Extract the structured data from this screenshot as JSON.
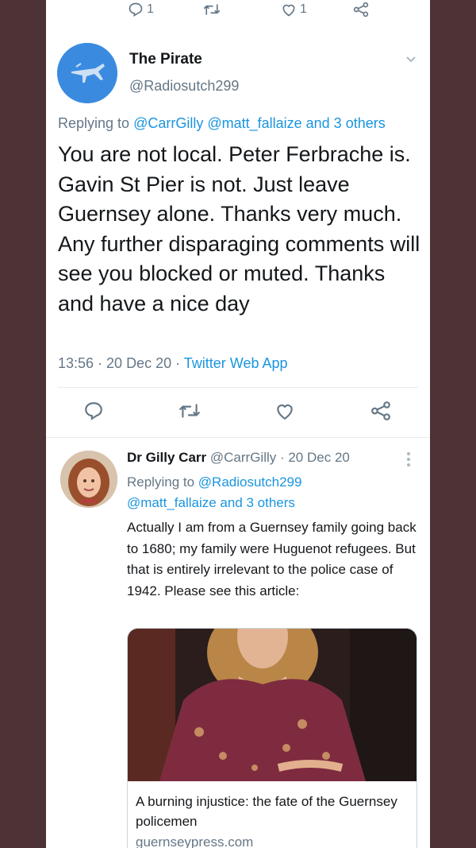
{
  "top_actions": {
    "reply_count": "1",
    "like_count": "1"
  },
  "main_tweet": {
    "display_name": "The Pirate",
    "handle": "@Radiosutch299",
    "replying_prefix": "Replying to ",
    "replying_to": "@CarrGilly @matt_fallaize and 3 others",
    "text": "You are not local. Peter Ferbrache is. Gavin St Pier is not. Just leave Guernsey alone. Thanks very much. Any further  disparaging comments will see you blocked or muted. Thanks and have a nice day",
    "time_date": "13:56 · 20 Dec 20 · ",
    "source": "Twitter Web App"
  },
  "reply_tweet": {
    "display_name": "Dr Gilly Carr",
    "handle_date": " @CarrGilly · 20 Dec 20",
    "replying_prefix": "Replying to ",
    "replying_to_1": "@Radiosutch299",
    "replying_to_2": "@matt_fallaize and 3 others",
    "text": "Actually I am from a Guernsey family going back to 1680; my family were Huguenot refugees. But that is entirely irrelevant to the police case of 1942. Please see this article:",
    "card": {
      "title": "A burning injustice: the fate of the Guernsey policemen",
      "domain": "guernseypress.com"
    }
  },
  "colors": {
    "background": "#4e3336",
    "link": "#1b95e0",
    "secondary_text": "#657786",
    "avatar_blue": "#3a8be0"
  },
  "icons": [
    "reply-icon",
    "retweet-icon",
    "like-icon",
    "share-icon",
    "chevron-down-icon",
    "more-icon",
    "plane-icon"
  ]
}
